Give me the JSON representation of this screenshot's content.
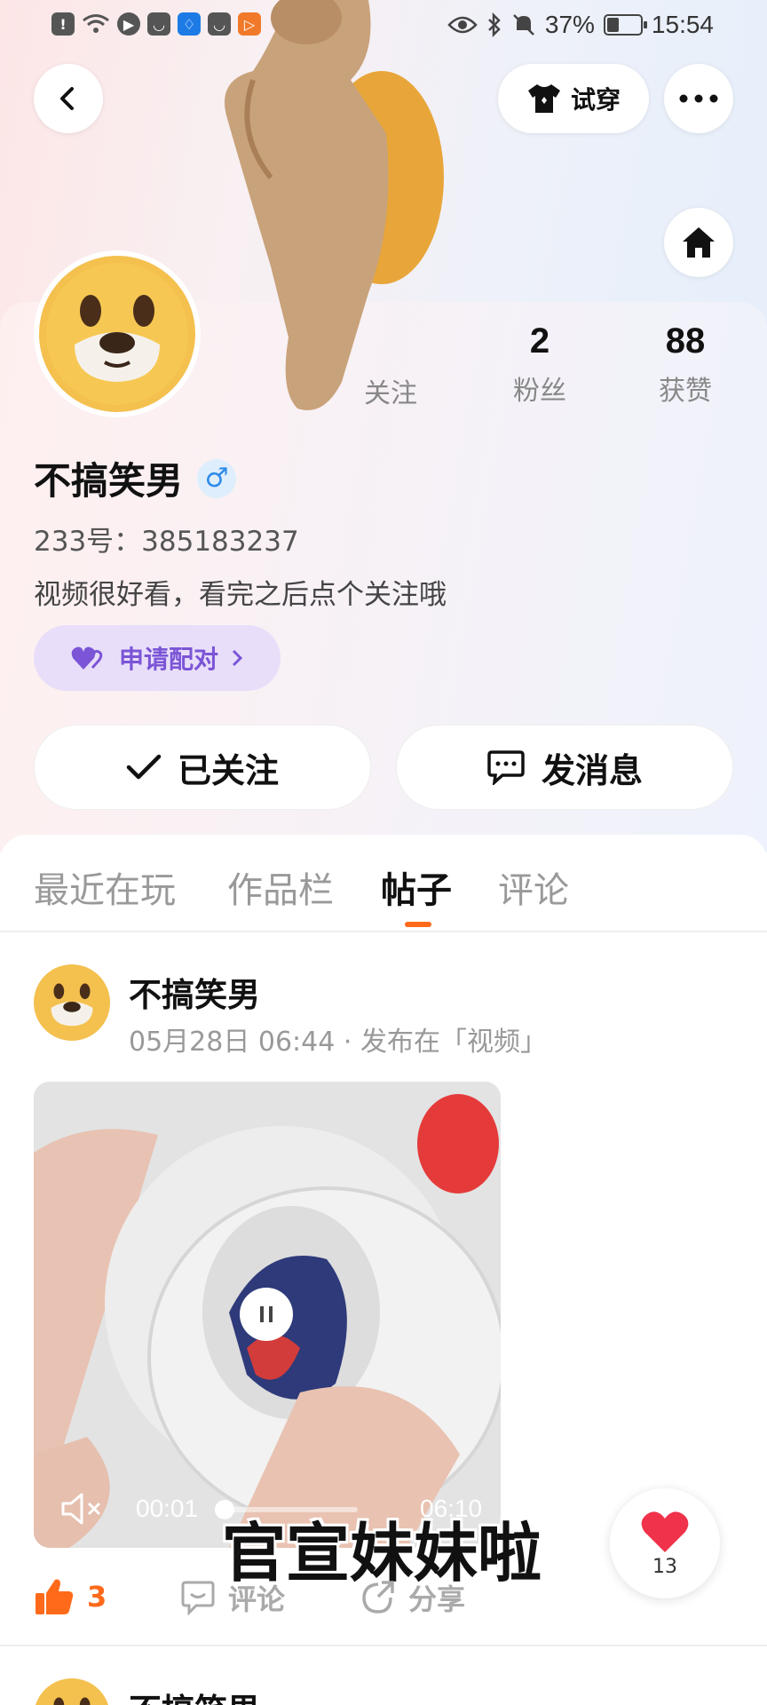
{
  "status_bar": {
    "battery": "37%",
    "battery_level": 0.37,
    "time": "15:54"
  },
  "header": {
    "try_on_label": "试穿"
  },
  "profile": {
    "stats": [
      {
        "value": "",
        "label": "关注"
      },
      {
        "value": "2",
        "label": "粉丝"
      },
      {
        "value": "88",
        "label": "获赞"
      }
    ],
    "username": "不搞笑男",
    "gender_symbol": "♂",
    "uid": "233号：385183237",
    "bio": "视频很好看，看完之后点个关注哦",
    "match_label": "申请配对",
    "follow_label": "已关注",
    "message_label": "发消息"
  },
  "tabs": [
    {
      "label": "最近在玩"
    },
    {
      "label": "作品栏"
    },
    {
      "label": "帖子",
      "active": true
    },
    {
      "label": "评论"
    }
  ],
  "post": {
    "author": "不搞笑男",
    "meta": "05月28日 06:44 · 发布在「视频」",
    "video": {
      "current_time": "00:01",
      "duration": "06:10",
      "progress": 0.003
    },
    "caption_overlay": "官宣妹妹啦",
    "likes": "3",
    "comment_label": "评论",
    "share_label": "分享",
    "float_heart_count": "13"
  },
  "next_post": {
    "author": "不搞笑男"
  },
  "colors": {
    "accent_orange": "#ff6a1a",
    "match_purple": "#7b55d6",
    "gender_blue": "#2e8be8",
    "heart_red": "#f0324b"
  }
}
